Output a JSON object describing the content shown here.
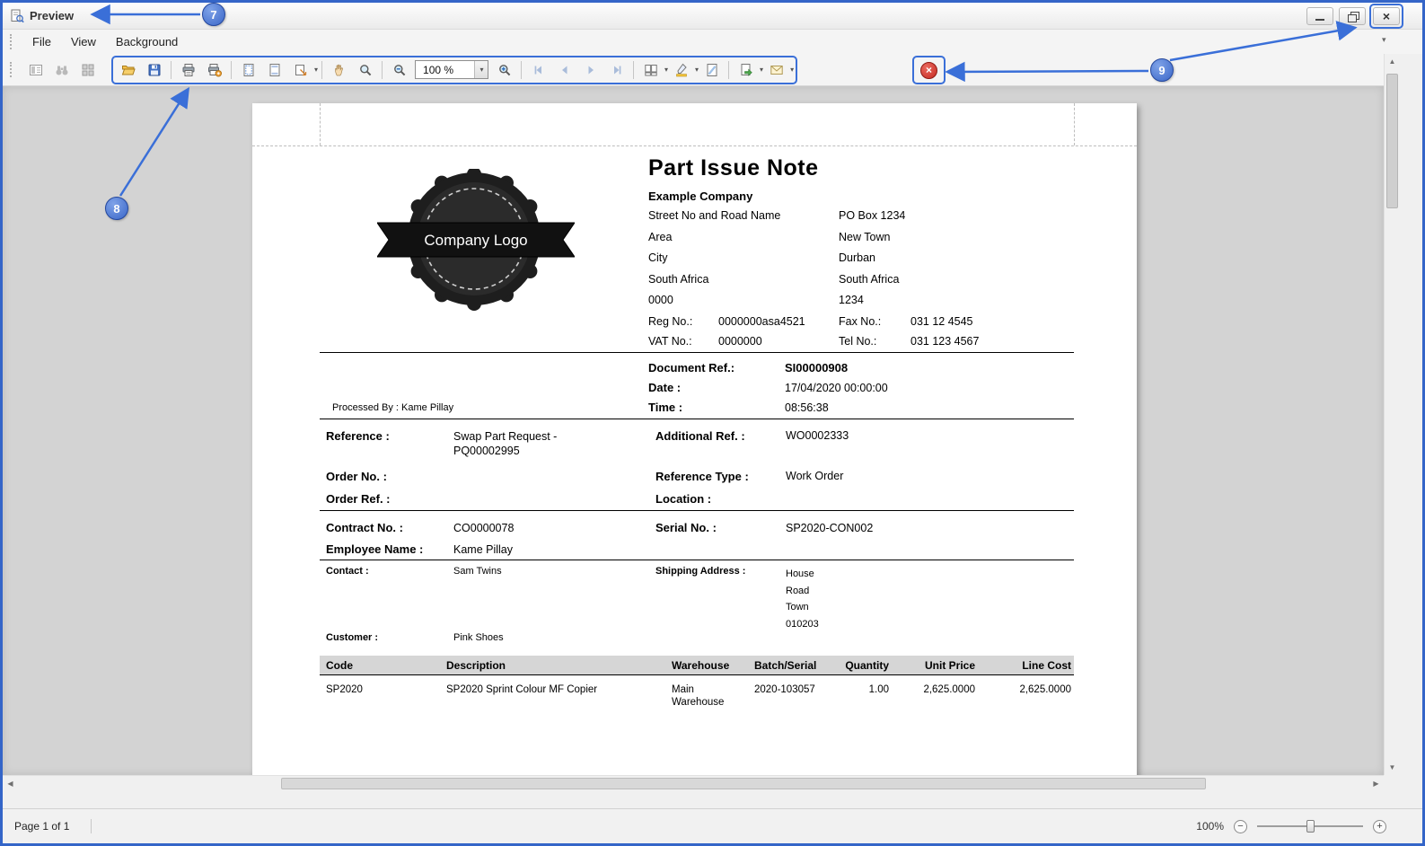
{
  "window": {
    "title": "Preview"
  },
  "menu": {
    "items": [
      "File",
      "View",
      "Background"
    ]
  },
  "toolbar": {
    "zoom_value": "100 %",
    "buttons": [
      "document-map",
      "search",
      "thumbnails",
      "open",
      "save",
      "print",
      "quick-print",
      "page-setup",
      "header-footer",
      "scale",
      "hand-tool",
      "magnifier",
      "zoom-out",
      "zoom",
      "zoom-in",
      "first-page",
      "previous-page",
      "next-page",
      "last-page",
      "multiple-pages",
      "page-color",
      "watermark",
      "export-document",
      "send-email",
      "close-preview"
    ]
  },
  "icons": {
    "close_window": "×",
    "close_preview": "×",
    "dropdown": "▾",
    "menu_overflow": "▾",
    "toolbar_overflow": "▾",
    "arrow_up": "▲",
    "arrow_down": "▼",
    "arrow_left": "◀",
    "arrow_right": "▶",
    "slider_minus": "−",
    "slider_plus": "+"
  },
  "statusbar": {
    "page_info": "Page 1 of 1",
    "zoom_percent": "100%"
  },
  "annotations": {
    "callouts": [
      "7",
      "8",
      "9"
    ]
  },
  "report": {
    "title": "Part Issue Note",
    "logo_text": "Company Logo",
    "company": {
      "name": "Example Company",
      "address_rows": [
        [
          "Street No and Road Name",
          "PO Box 1234"
        ],
        [
          "Area",
          "New Town"
        ],
        [
          "City",
          "Durban"
        ],
        [
          "South Africa",
          "South Africa"
        ],
        [
          "0000",
          "1234"
        ]
      ],
      "reg_label": "Reg No.:",
      "reg_value": "0000000asa4521",
      "fax_label": "Fax No.:",
      "fax_value": "031 12 4545",
      "vat_label": "VAT No.:",
      "vat_value": "0000000",
      "tel_label": "Tel No.:",
      "tel_value": "031 123 4567"
    },
    "doc_ref_label": "Document Ref.:",
    "doc_ref_value": "SI00000908",
    "date_label": "Date :",
    "date_value": "17/04/2020 00:00:00",
    "time_label": "Time :",
    "time_value": "08:56:38",
    "processed_by": "Processed By : Kame Pillay",
    "reference_label": "Reference :",
    "reference_value": "Swap Part Request - PQ00002995",
    "additional_ref_label": "Additional Ref. :",
    "additional_ref_value": "WO0002333",
    "order_no_label": "Order No. :",
    "reference_type_label": "Reference Type :",
    "reference_type_value": "Work Order",
    "order_ref_label": "Order Ref. :",
    "location_label": "Location :",
    "contract_no_label": "Contract No. :",
    "contract_no_value": "CO0000078",
    "serial_no_label": "Serial No. :",
    "serial_no_value": "SP2020-CON002",
    "employee_name_label": "Employee Name :",
    "employee_name_value": "Kame Pillay",
    "contact_label": "Contact :",
    "contact_value": "Sam Twins",
    "customer_label": "Customer :",
    "customer_value": "Pink Shoes",
    "shipping_label": "Shipping Address :",
    "shipping_lines": [
      "House",
      "Road",
      "Town",
      "010203"
    ],
    "table": {
      "headers": [
        "Code",
        "Description",
        "Warehouse",
        "Batch/Serial",
        "Quantity",
        "Unit Price",
        "Line Cost"
      ],
      "rows": [
        [
          "SP2020",
          "SP2020 Sprint Colour MF Copier",
          "Main Warehouse",
          "2020-103057",
          "1.00",
          "2,625.0000",
          "2,625.0000"
        ]
      ]
    }
  }
}
